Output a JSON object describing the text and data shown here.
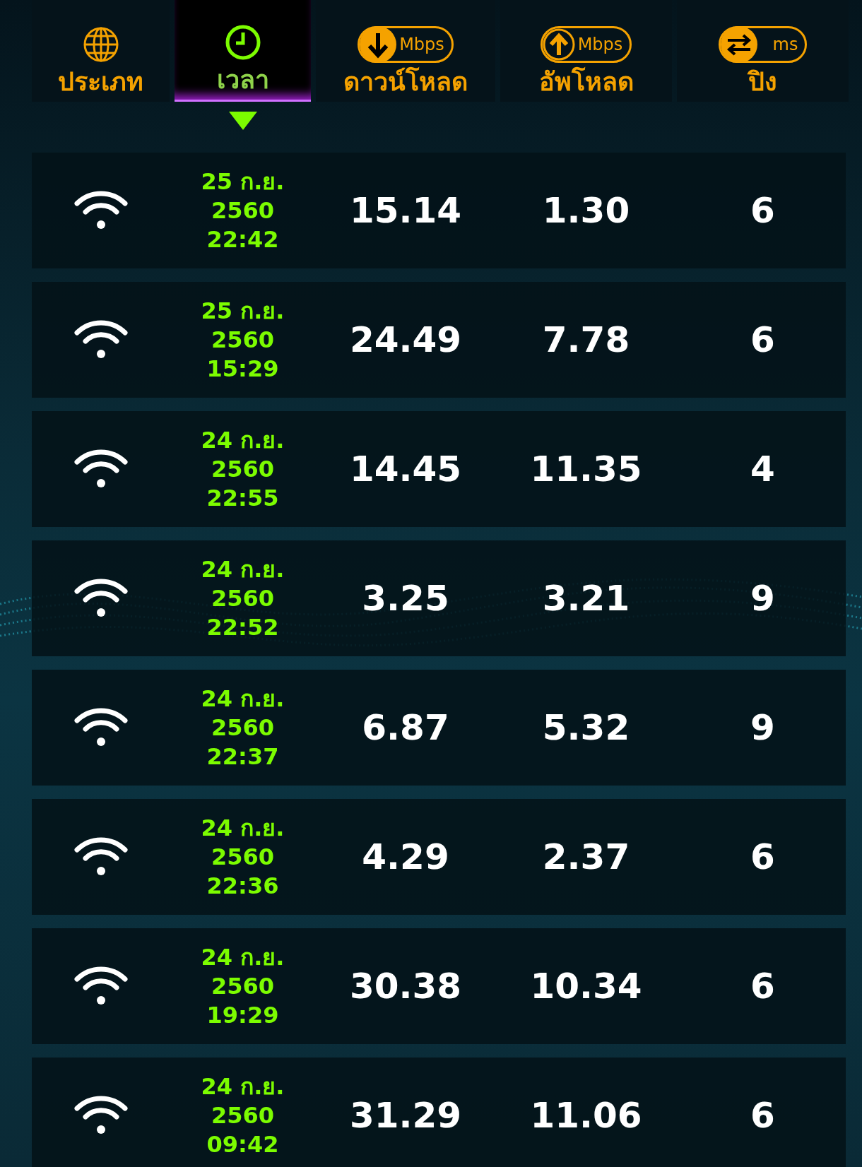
{
  "columns": [
    {
      "label": "ประเภท",
      "selected": false
    },
    {
      "label": "เวลา",
      "selected": true
    },
    {
      "label": "ดาวน์โหลด",
      "unit": "Mbps",
      "selected": false
    },
    {
      "label": "อัพโหลด",
      "unit": "Mbps",
      "selected": false
    },
    {
      "label": "ปิง",
      "unit": "ms",
      "selected": false
    }
  ],
  "rows": [
    {
      "date": "25 ก.ย.",
      "year": "2560",
      "time": "22:42",
      "download": "15.14",
      "upload": "1.30",
      "ping": "6"
    },
    {
      "date": "25 ก.ย.",
      "year": "2560",
      "time": "15:29",
      "download": "24.49",
      "upload": "7.78",
      "ping": "6"
    },
    {
      "date": "24 ก.ย.",
      "year": "2560",
      "time": "22:55",
      "download": "14.45",
      "upload": "11.35",
      "ping": "4"
    },
    {
      "date": "24 ก.ย.",
      "year": "2560",
      "time": "22:52",
      "download": "3.25",
      "upload": "3.21",
      "ping": "9"
    },
    {
      "date": "24 ก.ย.",
      "year": "2560",
      "time": "22:37",
      "download": "6.87",
      "upload": "5.32",
      "ping": "9"
    },
    {
      "date": "24 ก.ย.",
      "year": "2560",
      "time": "22:36",
      "download": "4.29",
      "upload": "2.37",
      "ping": "6"
    },
    {
      "date": "24 ก.ย.",
      "year": "2560",
      "time": "19:29",
      "download": "30.38",
      "upload": "10.34",
      "ping": "6"
    },
    {
      "date": "24 ก.ย.",
      "year": "2560",
      "time": "09:42",
      "download": "31.29",
      "upload": "11.06",
      "ping": "6"
    }
  ]
}
